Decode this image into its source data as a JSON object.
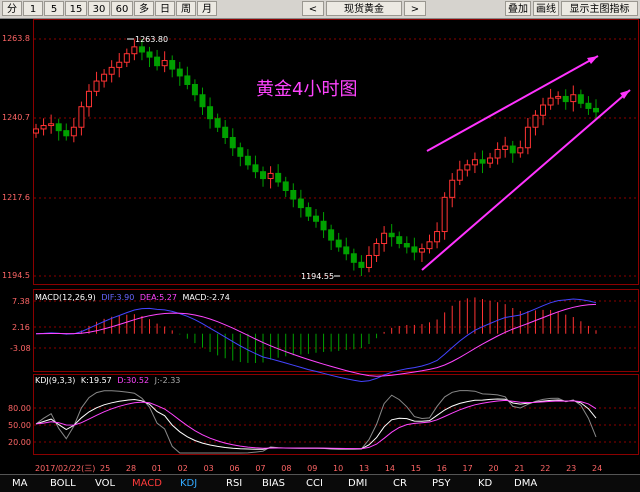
{
  "toolbar": {
    "buttons": [
      "分",
      "1",
      "5",
      "15",
      "30",
      "60",
      "多",
      "日",
      "周",
      "月"
    ],
    "prev": "<",
    "title": "现货黄金",
    "next": ">",
    "right_buttons": [
      "叠加",
      "画线",
      "显示主图指标"
    ]
  },
  "chart_data": {
    "type": "candlestick",
    "title": "黄金4小时图",
    "price_ticks": [
      "1263.8",
      "1240.7",
      "1217.6",
      "1194.5"
    ],
    "price_range": [
      1194.5,
      1263.8
    ],
    "high_label": "1263.80",
    "low_label": "1194.55",
    "date_start_label": "2017/02/22(三)",
    "date_labels": [
      "25",
      "28",
      "01",
      "02",
      "03",
      "06",
      "07",
      "08",
      "09",
      "10",
      "13",
      "14",
      "15",
      "16",
      "17",
      "20",
      "21",
      "22",
      "23",
      "24"
    ],
    "closes": [
      1237.5,
      1238.5,
      1239.0,
      1237.0,
      1235.5,
      1238.0,
      1244.0,
      1248.5,
      1251.5,
      1253.5,
      1255.5,
      1257.0,
      1259.5,
      1261.5,
      1260.0,
      1258.5,
      1256.0,
      1257.5,
      1255.0,
      1253.0,
      1250.5,
      1247.5,
      1244.0,
      1240.5,
      1238.0,
      1235.0,
      1232.0,
      1229.5,
      1227.0,
      1225.0,
      1223.0,
      1224.5,
      1222.0,
      1219.5,
      1217.0,
      1214.5,
      1212.0,
      1210.5,
      1208.0,
      1205.0,
      1203.0,
      1201.0,
      1198.5,
      1197.0,
      1200.5,
      1204.0,
      1207.0,
      1206.0,
      1204.0,
      1203.0,
      1201.5,
      1202.5,
      1204.5,
      1207.5,
      1217.5,
      1222.5,
      1225.5,
      1227.0,
      1228.5,
      1227.5,
      1229.0,
      1231.5,
      1232.5,
      1230.5,
      1232.0,
      1238.0,
      1241.5,
      1244.5,
      1246.5,
      1247.0,
      1245.5,
      1247.5,
      1245.0,
      1243.5,
      1242.5
    ],
    "macd": {
      "label": "MACD(12,26,9)",
      "dif": "DIF:3.90",
      "dea": "DEA:5.27",
      "macd": "MACD:-2.74",
      "ticks": [
        "7.38",
        "2.16",
        "-3.08"
      ],
      "range": [
        -8.0,
        9.5
      ]
    },
    "kdj": {
      "label": "KDJ(9,3,3)",
      "k": "K:19.57",
      "d": "D:30.52",
      "j": "J:-2.33",
      "ticks": [
        "80.00",
        "50.00",
        "20.00"
      ],
      "range": [
        0,
        110
      ]
    },
    "colors": {
      "up": "#ff3333",
      "down": "#00a000",
      "title": "#ff44ff",
      "trend": "#ff33ff",
      "axis": "#8b0000",
      "label": "#ffffff"
    }
  },
  "bottom_tabs": [
    "MA",
    "BOLL",
    "VOL",
    "MACD",
    "KDJ",
    "RSI",
    "BIAS",
    "CCI",
    "DMI",
    "CR",
    "PSY",
    "KD",
    "DMA"
  ]
}
